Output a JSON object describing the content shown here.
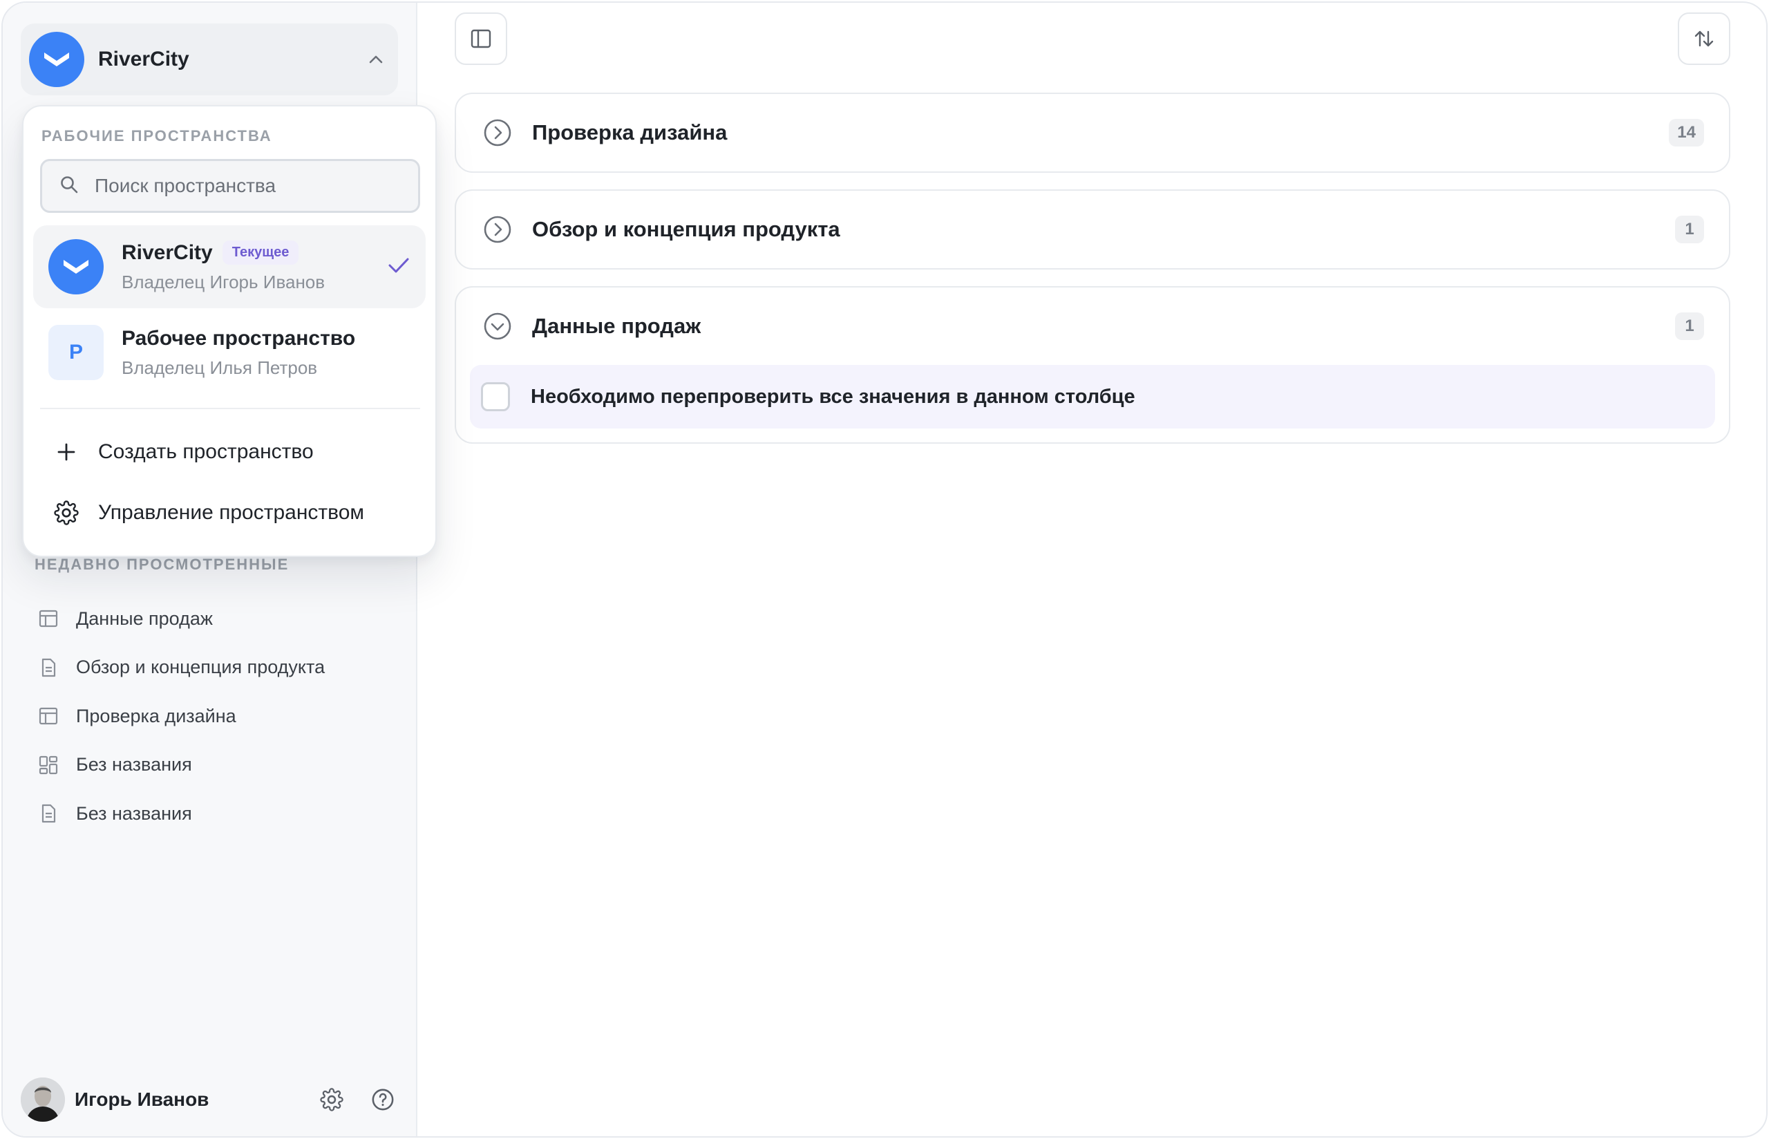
{
  "workspace": {
    "current_name": "RiverCity",
    "brand_color": "#3b82f6",
    "accent_color": "#6d5bd0"
  },
  "dropdown": {
    "section_title": "РАБОЧИЕ ПРОСТРАНСТВА",
    "search_placeholder": "Поиск пространства",
    "items": [
      {
        "name": "RiverCity",
        "badge": "Текущее",
        "owner": "Владелец Игорь Иванов",
        "icon": "rivercity-logo-icon",
        "selected": true
      },
      {
        "name": "Рабочее пространство",
        "initial": "Р",
        "owner": "Владелец Илья Петров",
        "icon": "letter-avatar"
      }
    ],
    "actions": [
      {
        "label": "Создать пространство",
        "icon": "plus-icon"
      },
      {
        "label": "Управление пространством",
        "icon": "gear-icon"
      }
    ]
  },
  "sidebar": {
    "recent_title": "НЕДАВНО ПРОСМОТРЕННЫЕ",
    "recent": [
      {
        "label": "Данные продаж",
        "icon": "table-icon"
      },
      {
        "label": "Обзор и концепция продукта",
        "icon": "document-icon"
      },
      {
        "label": "Проверка дизайна",
        "icon": "table-icon"
      },
      {
        "label": "Без названия",
        "icon": "dashboard-icon"
      },
      {
        "label": "Без названия",
        "icon": "document-icon"
      }
    ]
  },
  "user": {
    "name": "Игорь Иванов"
  },
  "main": {
    "groups": [
      {
        "title": "Проверка дизайна",
        "count": "14",
        "expanded": false
      },
      {
        "title": "Обзор и концепция продукта",
        "count": "1",
        "expanded": false
      },
      {
        "title": "Данные продаж",
        "count": "1",
        "expanded": true,
        "tasks": [
          {
            "text": "Необходимо перепроверить все значения в данном столбце",
            "checked": false
          }
        ]
      }
    ]
  }
}
